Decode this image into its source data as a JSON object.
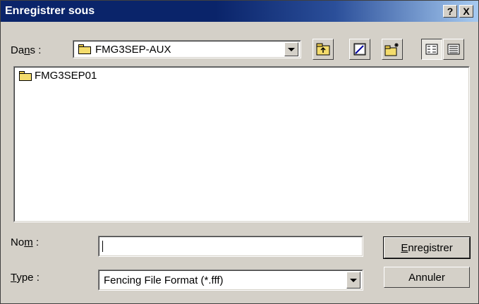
{
  "window": {
    "title": "Enregistrer sous"
  },
  "title_buttons": {
    "help": "?",
    "close": "X"
  },
  "look_in": {
    "label_pre": "Da",
    "label_accel": "n",
    "label_post": "s :",
    "value": "FMG3SEP-AUX"
  },
  "toolbar": [
    {
      "icon": "up-folder-icon"
    },
    {
      "icon": "desktop-icon"
    },
    {
      "icon": "new-folder-icon"
    },
    {
      "icon": "list-view-icon"
    },
    {
      "icon": "details-view-icon"
    }
  ],
  "files": [
    {
      "name": "FMG3SEP01",
      "icon": "folder-icon"
    }
  ],
  "filename": {
    "label_pre": "No",
    "label_accel": "m",
    "label_post": " :",
    "value": ""
  },
  "filetype": {
    "label_accel": "T",
    "label_post": "ype :",
    "value": "Fencing File Format (*.fff)"
  },
  "buttons": {
    "save_accel": "E",
    "save_rest": "nregistrer",
    "cancel": "Annuler"
  },
  "colors": {
    "titlebar": "#0a246a",
    "face": "#d4d0c8",
    "folder": "#f4dc6c"
  }
}
